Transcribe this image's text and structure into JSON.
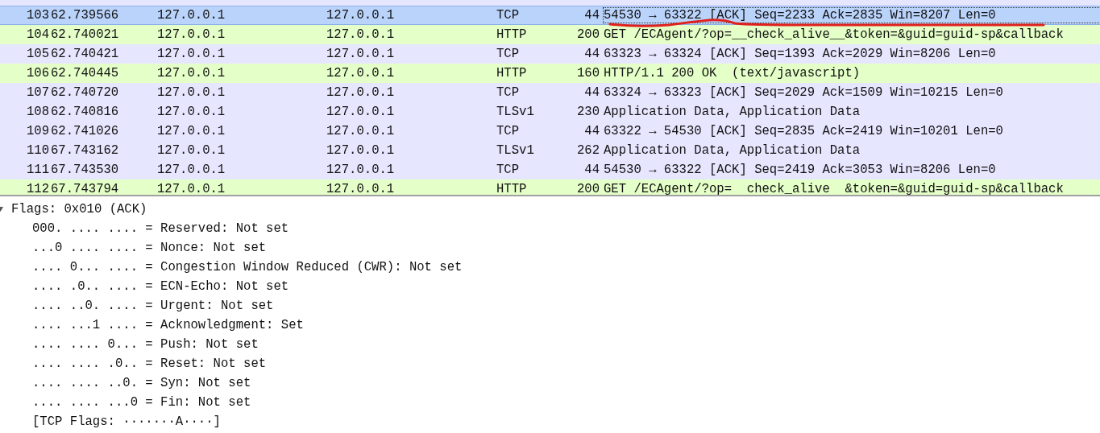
{
  "packets": [
    {
      "no": "103",
      "time": "62.739566",
      "source": "127.0.0.1",
      "destination": "127.0.0.1",
      "protocol": "TCP",
      "length": "44",
      "info": "54530 → 63322 [ACK] Seq=2233 Ack=2835 Win=8207 Len=0",
      "selected": true
    },
    {
      "no": "104",
      "time": "62.740021",
      "source": "127.0.0.1",
      "destination": "127.0.0.1",
      "protocol": "HTTP",
      "length": "200",
      "info": "GET /ECAgent/?op=__check_alive__&token=&guid=guid-sp&callback",
      "color": "#e4ffc7",
      "selected": false
    },
    {
      "no": "105",
      "time": "62.740421",
      "source": "127.0.0.1",
      "destination": "127.0.0.1",
      "protocol": "TCP",
      "length": "44",
      "info": "63323 → 63324 [ACK] Seq=1393 Ack=2029 Win=8206 Len=0",
      "color": "#e7e6ff",
      "selected": false
    },
    {
      "no": "106",
      "time": "62.740445",
      "source": "127.0.0.1",
      "destination": "127.0.0.1",
      "protocol": "HTTP",
      "length": "160",
      "info": "HTTP/1.1 200 OK  (text/javascript)",
      "color": "#e4ffc7",
      "selected": false
    },
    {
      "no": "107",
      "time": "62.740720",
      "source": "127.0.0.1",
      "destination": "127.0.0.1",
      "protocol": "TCP",
      "length": "44",
      "info": "63324 → 63323 [ACK] Seq=2029 Ack=1509 Win=10215 Len=0",
      "color": "#e7e6ff",
      "selected": false
    },
    {
      "no": "108",
      "time": "62.740816",
      "source": "127.0.0.1",
      "destination": "127.0.0.1",
      "protocol": "TLSv1",
      "length": "230",
      "info": "Application Data, Application Data",
      "color": "#e7e6ff",
      "selected": false
    },
    {
      "no": "109",
      "time": "62.741026",
      "source": "127.0.0.1",
      "destination": "127.0.0.1",
      "protocol": "TCP",
      "length": "44",
      "info": "63322 → 54530 [ACK] Seq=2835 Ack=2419 Win=10201 Len=0",
      "color": "#e7e6ff",
      "selected": false
    },
    {
      "no": "110",
      "time": "67.743162",
      "source": "127.0.0.1",
      "destination": "127.0.0.1",
      "protocol": "TLSv1",
      "length": "262",
      "info": "Application Data, Application Data",
      "color": "#e7e6ff",
      "selected": false
    },
    {
      "no": "111",
      "time": "67.743530",
      "source": "127.0.0.1",
      "destination": "127.0.0.1",
      "protocol": "TCP",
      "length": "44",
      "info": "54530 → 63322 [ACK] Seq=2419 Ack=3053 Win=8206 Len=0",
      "color": "#e7e6ff",
      "selected": false
    },
    {
      "no": "112",
      "time": "67.743794",
      "source": "127.0.0.1",
      "destination": "127.0.0.1",
      "protocol": "HTTP",
      "length": "200",
      "info": "GET /ECAgent/?op=  check_alive  &token=&guid=guid-sp&callback",
      "color": "#e4ffc7",
      "selected": false
    }
  ],
  "details": [
    {
      "label": "Flags: 0x010 (ACK)",
      "expanded": true,
      "children": [
        {
          "label": "000. .... .... = Reserved: Not set"
        },
        {
          "label": "...0 .... .... = Nonce: Not set"
        },
        {
          "label": ".... 0... .... = Congestion Window Reduced (CWR): Not set"
        },
        {
          "label": ".... .0.. .... = ECN-Echo: Not set"
        },
        {
          "label": ".... ..0. .... = Urgent: Not set"
        },
        {
          "label": ".... ...1 .... = Acknowledgment: Set"
        },
        {
          "label": ".... .... 0... = Push: Not set"
        },
        {
          "label": ".... .... .0.. = Reset: Not set"
        },
        {
          "label": ".... .... ..0. = Syn: Not set"
        },
        {
          "label": ".... .... ...0 = Fin: Not set"
        },
        {
          "label": "[TCP Flags: ·······A····]"
        }
      ]
    }
  ]
}
